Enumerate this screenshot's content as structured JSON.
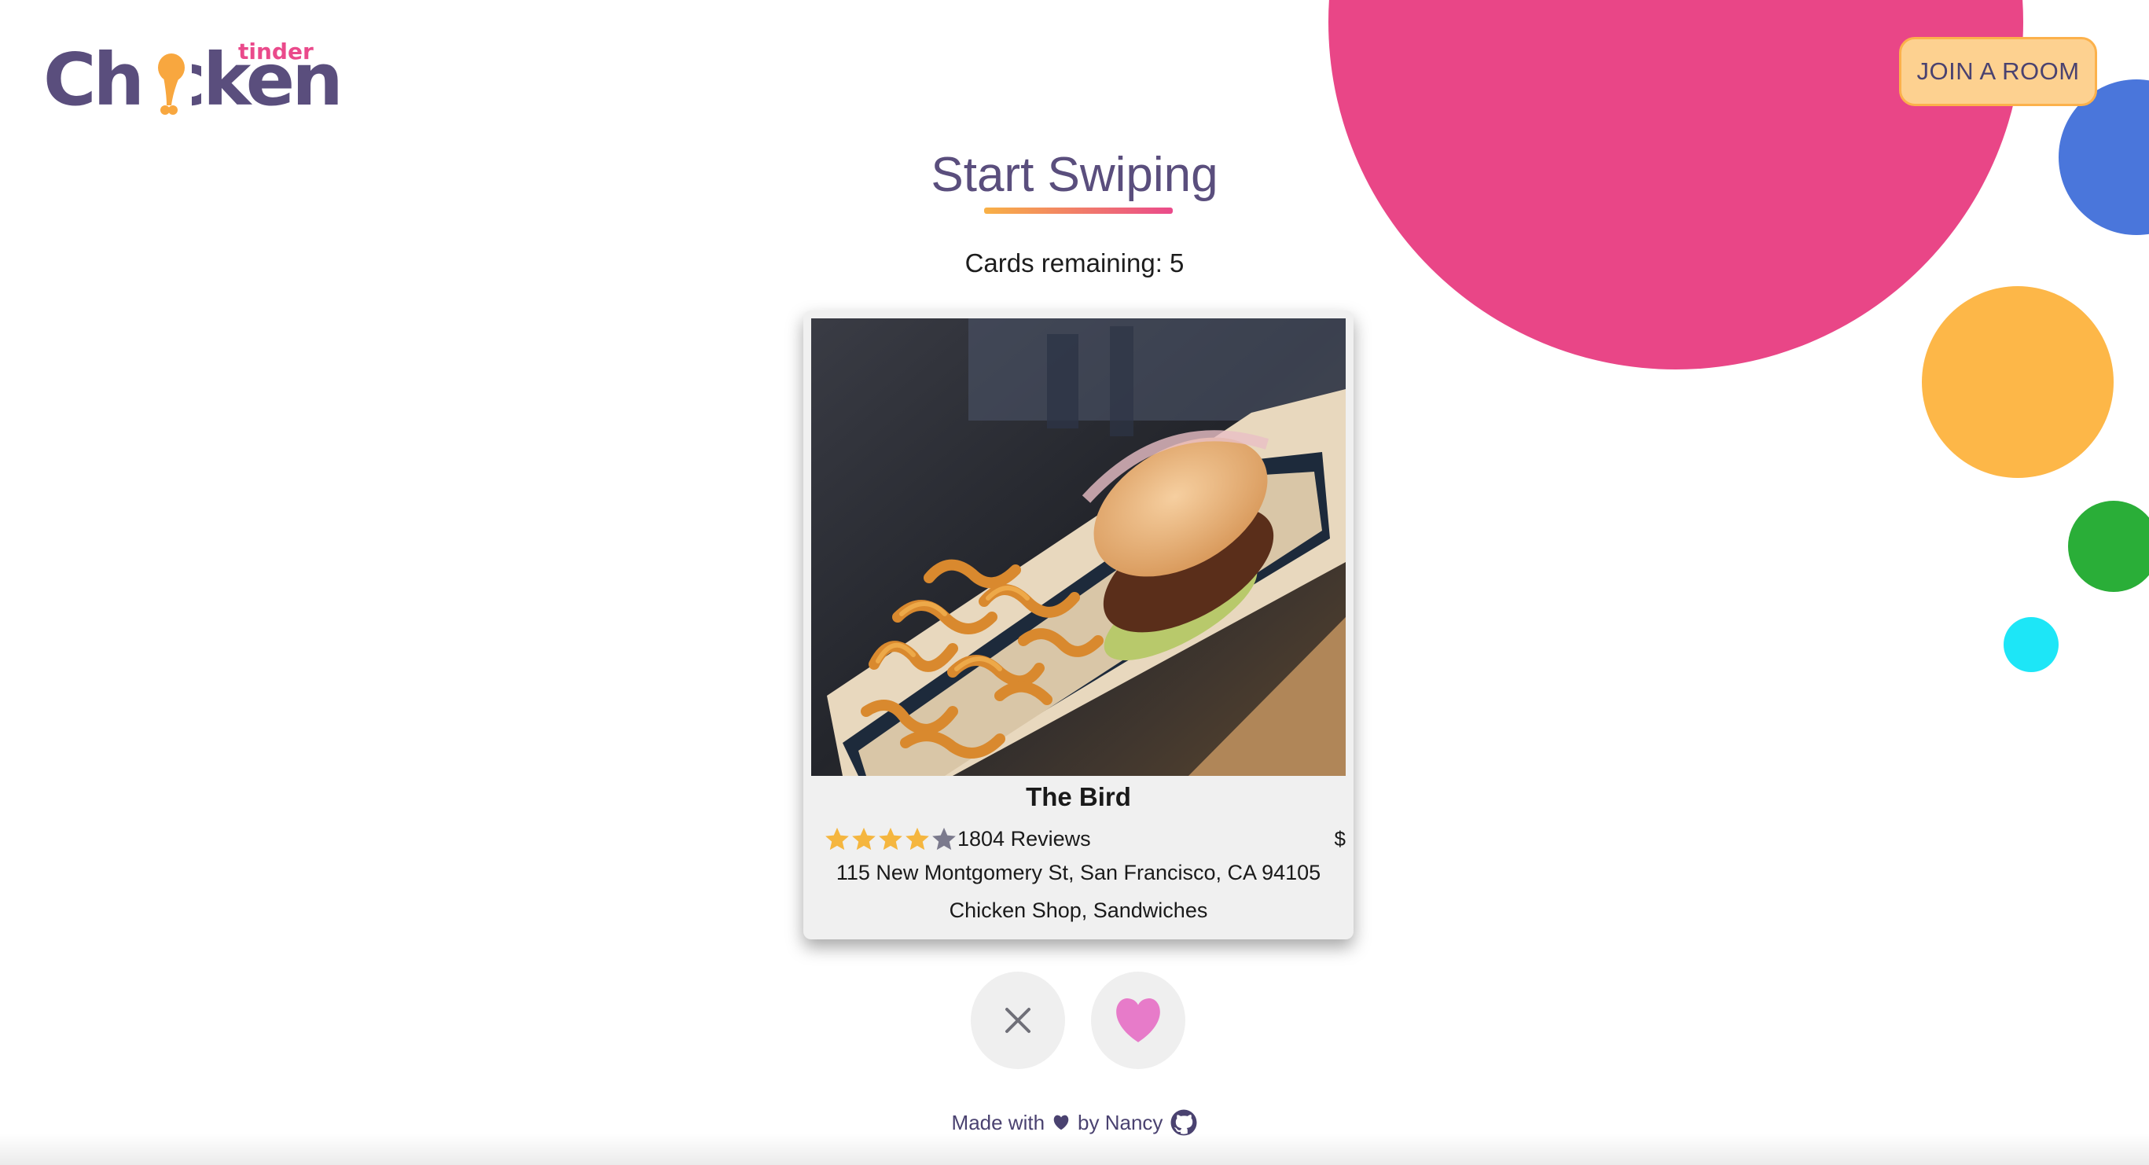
{
  "logo": {
    "word": "Chicken",
    "subtitle": "tinder"
  },
  "header": {
    "join_button_label": "JOIN A ROOM"
  },
  "main": {
    "title": "Start Swiping",
    "cards_remaining_label": "Cards remaining: 5"
  },
  "card": {
    "name": "The Bird",
    "rating": 4,
    "rating_max": 5,
    "reviews": "1804 Reviews",
    "price": "$",
    "address": "115 New Montgomery St, San Francisco, CA 94105",
    "categories": "Chicken Shop, Sandwiches",
    "photo_icon": "food-photo"
  },
  "actions": {
    "nope_icon": "close-icon",
    "like_icon": "heart-icon"
  },
  "footer": {
    "made_with": "Made with",
    "by": "by Nancy",
    "github_icon": "github-icon"
  },
  "colors": {
    "brand_purple": "#5a4e7d",
    "brand_pink": "#ea4a8b",
    "brand_orange": "#fcb14b",
    "star_filled": "#f5b63f",
    "star_empty": "#7b7a8d",
    "like_heart": "#e77bc9"
  }
}
